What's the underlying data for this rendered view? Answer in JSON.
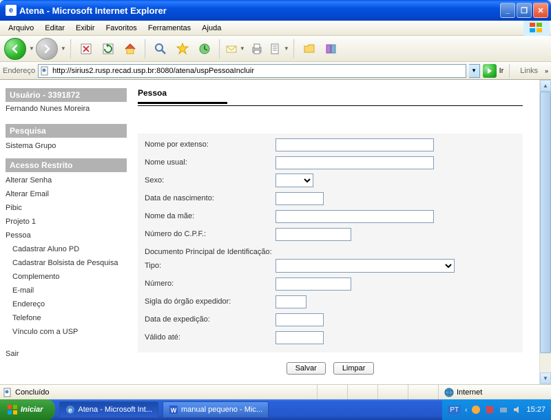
{
  "window": {
    "title": "Atena - Microsoft Internet Explorer"
  },
  "menu": {
    "arquivo": "Arquivo",
    "editar": "Editar",
    "exibir": "Exibir",
    "favoritos": "Favoritos",
    "ferramentas": "Ferramentas",
    "ajuda": "Ajuda"
  },
  "address": {
    "label": "Endereço",
    "url": "http://sirius2.rusp.recad.usp.br:8080/atena/uspPessoaIncluir",
    "go": "Ir",
    "links": "Links"
  },
  "sidebar": {
    "user_hdr": "Usuário - 3391872",
    "user_name": "Fernando Nunes Moreira",
    "pesquisa_hdr": "Pesquisa",
    "sistema_grupo": "Sistema Grupo",
    "acesso_hdr": "Acesso Restrito",
    "items": {
      "alterar_senha": "Alterar Senha",
      "alterar_email": "Alterar Email",
      "pibic": "Pibic",
      "projeto1": "Projeto 1",
      "pessoa": "Pessoa",
      "cadastrar_aluno": "Cadastrar Aluno PD",
      "cadastrar_bolsista": "Cadastrar Bolsista de Pesquisa",
      "complemento": "Complemento",
      "email": "E-mail",
      "endereco": "Endereço",
      "telefone": "Telefone",
      "vinculo": "Vínculo com a USP",
      "sair": "Sair"
    }
  },
  "main": {
    "title": "Pessoa",
    "labels": {
      "nome_extenso": "Nome por extenso:",
      "nome_usual": "Nome usual:",
      "sexo": "Sexo:",
      "data_nasc": "Data de nascimento:",
      "nome_mae": "Nome da mãe:",
      "cpf": "Número do C.P.F.:",
      "doc_principal": "Documento Principal de Identificação:",
      "tipo": "Tipo:",
      "numero": "Número:",
      "sigla": "Sigla do órgão expedidor:",
      "data_exp": "Data de expedição:",
      "valido_ate": "Válido até:"
    },
    "buttons": {
      "salvar": "Salvar",
      "limpar": "Limpar"
    }
  },
  "status": {
    "concluido": "Concluído",
    "zone": "Internet"
  },
  "taskbar": {
    "start": "Iniciar",
    "task1": "Atena - Microsoft Int...",
    "task2": "manual pequeno - Mic...",
    "lang": "PT",
    "clock": "15:27"
  }
}
